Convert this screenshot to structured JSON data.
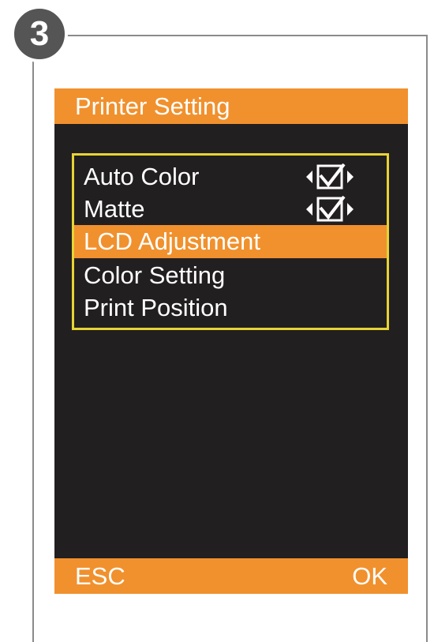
{
  "step": {
    "number": "3"
  },
  "screen": {
    "title": "Printer Setting",
    "menu": {
      "items": [
        {
          "label": "Auto Color",
          "checked": true
        },
        {
          "label": "Matte",
          "checked": true
        },
        {
          "label": "LCD Adjustment",
          "selected": true
        },
        {
          "label": "Color Setting"
        },
        {
          "label": "Print Position"
        }
      ]
    },
    "footer": {
      "left": "ESC",
      "right": "OK"
    }
  },
  "colors": {
    "accent": "#f0912e",
    "screen_bg": "#221f20",
    "menu_border": "#e6d434",
    "badge": "#555555"
  },
  "icons": {
    "left_arrow": "triangle-left",
    "right_arrow": "triangle-right",
    "checkbox": "checked-box"
  }
}
